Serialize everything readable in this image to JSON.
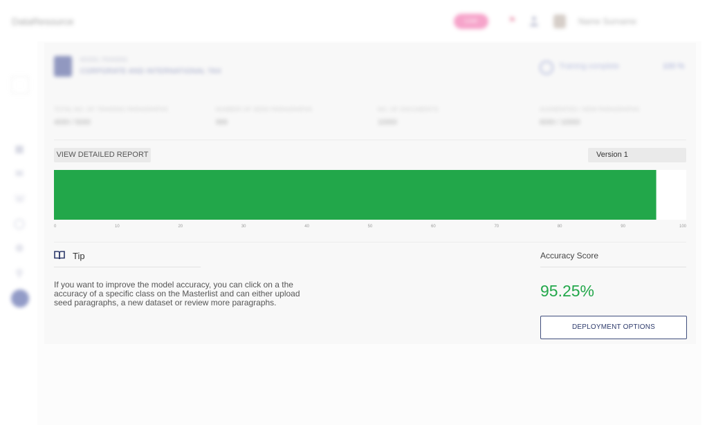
{
  "app": {
    "brand": "DataResource"
  },
  "header": {
    "badge": "Live",
    "user_name": "Name Surname"
  },
  "model": {
    "kicker": "MODEL TRAINING",
    "title": "CORPORATE AND INTERNATIONAL TAX",
    "training_label": "Training complete",
    "training_value": "100 %"
  },
  "stats": [
    {
      "label": "TOTAL NO. OF TRAINING PARAGRAPHS",
      "value": "4000 / 5000"
    },
    {
      "label": "NUMBER OF SEED PARAGRAPHS",
      "value": "999"
    },
    {
      "label": "NO. OF DOCUMENTS",
      "value": "10000"
    },
    {
      "label": "AUGMENTED / NEW PARAGRAPHS",
      "value": "6000 / 10000"
    }
  ],
  "report": {
    "view_button": "VIEW DETAILED REPORT",
    "version": "Version 1"
  },
  "chart_data": {
    "type": "bar",
    "orientation": "horizontal",
    "values": [
      95.25
    ],
    "xlim": [
      0,
      100
    ],
    "ticks": [
      "0",
      "10",
      "20",
      "30",
      "40",
      "50",
      "60",
      "70",
      "80",
      "90",
      "100"
    ],
    "bar_color": "#22a74a",
    "track_color": "#ffffff"
  },
  "tip": {
    "title": "Tip",
    "text": "If you want to improve the model accuracy, you can click on a the accuracy of a specific class on the Masterlist and can either upload seed paragraphs, a new dataset or review more paragraphs."
  },
  "accuracy": {
    "label": "Accuracy Score",
    "value": "95.25%",
    "color": "#22a74a"
  },
  "actions": {
    "deploy_button": "DEPLOYMENT OPTIONS"
  },
  "icons": {
    "sidebar": [
      "menu-icon",
      "grid-icon",
      "chat-icon",
      "phone-icon",
      "globe-icon",
      "settings-icon",
      "search-icon",
      "active-circle-icon"
    ],
    "tip": "book-icon"
  }
}
